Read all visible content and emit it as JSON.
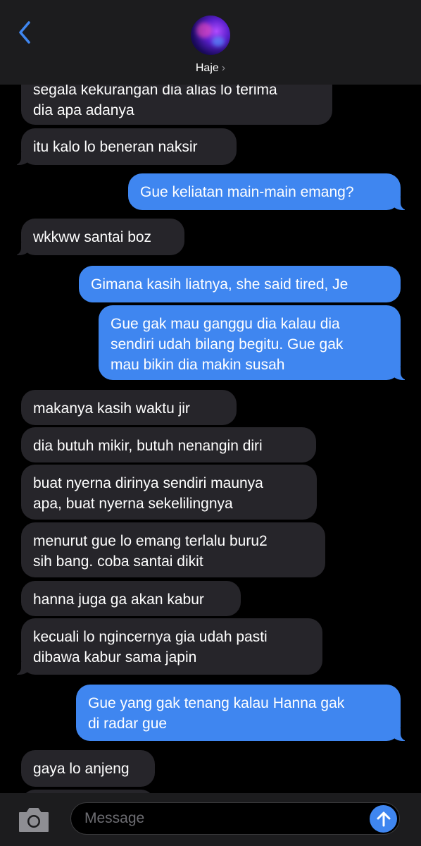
{
  "header": {
    "contact_name": "Haje",
    "chevron": "›"
  },
  "messages": [
    {
      "dir": "in",
      "lines": [
        "segala kekurangan dia alias lo terima",
        "dia apa adanya"
      ]
    },
    {
      "dir": "in",
      "lines": [
        "itu kalo lo beneran naksir"
      ]
    },
    {
      "dir": "out",
      "lines": [
        "Gue keliatan main-main emang?"
      ]
    },
    {
      "dir": "in",
      "lines": [
        "wkkww santai boz"
      ]
    },
    {
      "dir": "out",
      "lines": [
        "Gimana kasih liatnya, she said tired, Je"
      ]
    },
    {
      "dir": "out",
      "lines": [
        "Gue gak mau ganggu dia kalau dia",
        "sendiri udah bilang begitu. Gue gak",
        "mau bikin dia makin susah"
      ]
    },
    {
      "dir": "in",
      "lines": [
        "makanya kasih waktu jir"
      ]
    },
    {
      "dir": "in",
      "lines": [
        "dia butuh mikir, butuh nenangin diri"
      ]
    },
    {
      "dir": "in",
      "lines": [
        "buat nyerna dirinya sendiri maunya",
        "apa, buat nyerna sekelilingnya"
      ]
    },
    {
      "dir": "in",
      "lines": [
        "menurut gue lo emang terlalu buru2",
        "sih bang. coba santai dikit"
      ]
    },
    {
      "dir": "in",
      "lines": [
        "hanna juga ga akan kabur"
      ]
    },
    {
      "dir": "in",
      "lines": [
        "kecuali lo ngincernya gia udah pasti",
        "dibawa kabur sama japin"
      ]
    },
    {
      "dir": "out",
      "lines": [
        "Gue yang gak tenang kalau Hanna gak",
        "di radar gue"
      ]
    },
    {
      "dir": "in",
      "lines": [
        "gaya lo anjeng"
      ]
    }
  ],
  "composer": {
    "placeholder": "Message",
    "camera_icon": "camera-icon",
    "send_icon": "arrow-up-icon"
  },
  "colors": {
    "incoming_bubble": "#26252a",
    "outgoing_bubble": "#3f86f0",
    "accent": "#3f86f0",
    "background": "#000000"
  }
}
